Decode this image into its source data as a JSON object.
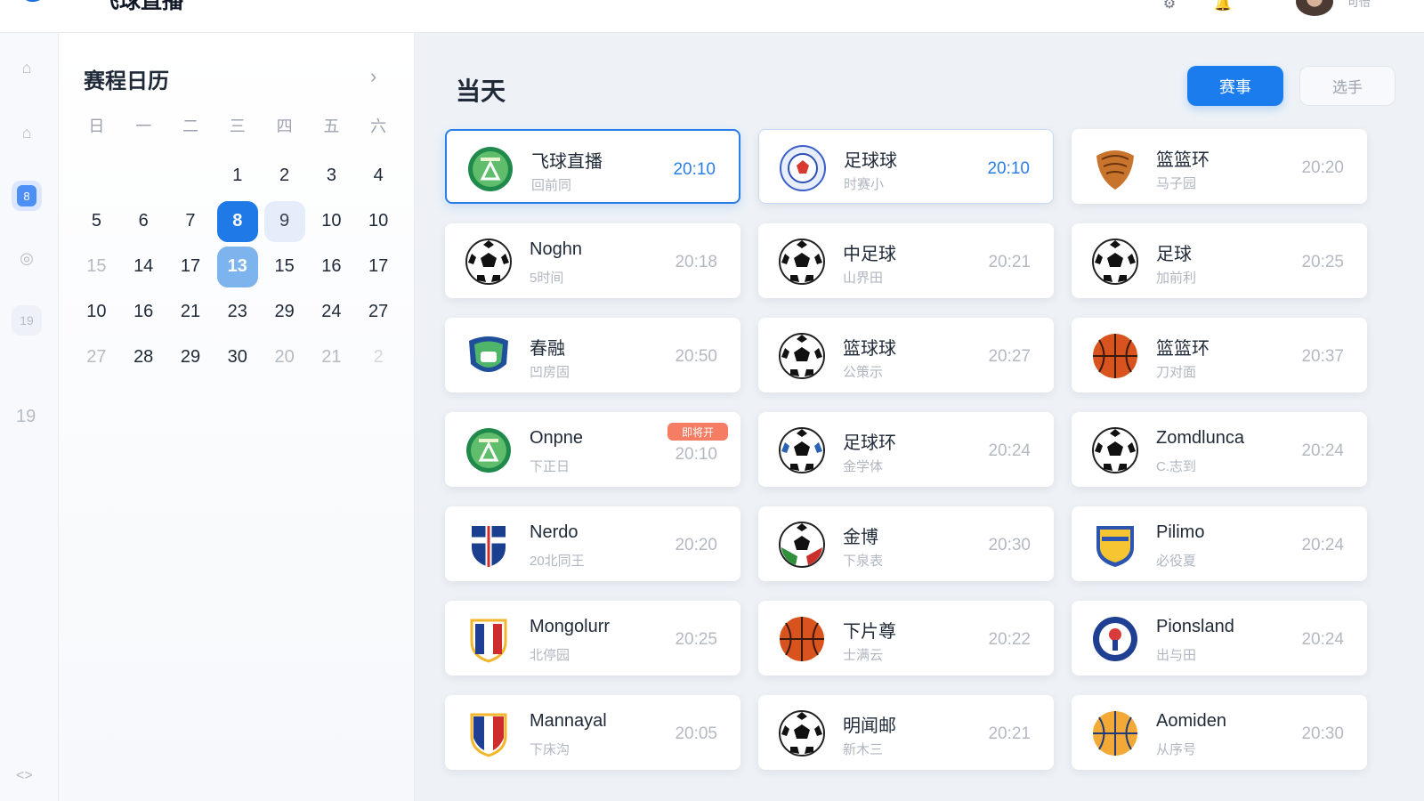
{
  "header": {
    "app_title": "飞球直播",
    "user_name": "可怡",
    "icons": [
      "logo-mark",
      "settings-icon",
      "notification-icon",
      "avatar"
    ]
  },
  "rail": {
    "items": [
      {
        "name": "home",
        "icon": "home-icon",
        "state": "inactive"
      },
      {
        "name": "stadium",
        "icon": "stadium-icon",
        "state": "inactive"
      },
      {
        "name": "schedule",
        "icon": "calendar-icon",
        "state": "active",
        "label": "8"
      },
      {
        "name": "record",
        "icon": "record-icon",
        "state": "inactive"
      },
      {
        "name": "highlights",
        "icon": "highlights-icon",
        "state": "soft",
        "label": "19"
      }
    ],
    "number": "19",
    "bottom": "<>"
  },
  "calendar": {
    "title": "赛程日历",
    "next_icon": "chevron-right-icon",
    "weekdays": [
      "日",
      "一",
      "二",
      "三",
      "四",
      "五",
      "六"
    ],
    "rows": [
      [
        {
          "d": ""
        },
        {
          "d": ""
        },
        {
          "d": ""
        },
        {
          "d": "1"
        },
        {
          "d": "2"
        },
        {
          "d": "3"
        },
        {
          "d": "4"
        }
      ],
      [
        {
          "d": "5"
        },
        {
          "d": "6"
        },
        {
          "d": "7"
        },
        {
          "d": "8",
          "state": "sel"
        },
        {
          "d": "9",
          "state": "near"
        },
        {
          "d": "10"
        },
        {
          "d": "10"
        }
      ],
      [
        {
          "d": "15",
          "state": "muted"
        },
        {
          "d": "14"
        },
        {
          "d": "17"
        },
        {
          "d": "13",
          "state": "today"
        },
        {
          "d": "15"
        },
        {
          "d": "16"
        },
        {
          "d": "17"
        }
      ],
      [
        {
          "d": "10"
        },
        {
          "d": "16"
        },
        {
          "d": "21"
        },
        {
          "d": "23"
        },
        {
          "d": "29"
        },
        {
          "d": "24"
        },
        {
          "d": "27"
        }
      ],
      [
        {
          "d": "27",
          "state": "muted"
        },
        {
          "d": "28"
        },
        {
          "d": "29"
        },
        {
          "d": "30"
        },
        {
          "d": "20",
          "state": "muted"
        },
        {
          "d": "21",
          "state": "muted"
        },
        {
          "d": "2",
          "state": "faint"
        }
      ]
    ]
  },
  "main": {
    "title": "当天",
    "primary_button": "赛事",
    "secondary_button": "选手",
    "badge_text": "即将开",
    "cards": [
      {
        "name": "飞球直播",
        "sub": "回前同",
        "time": "20:10",
        "logo": "green-shield",
        "state": "active",
        "time_color": "blue"
      },
      {
        "name": "足球球",
        "sub": "时赛小",
        "time": "20:10",
        "logo": "blue-ball-crest",
        "state": "soft-active",
        "time_color": "blue"
      },
      {
        "name": "篮篮环",
        "sub": "马子园",
        "time": "20:20",
        "logo": "basket-crest"
      },
      {
        "name": "Noghn",
        "sub": "5时间",
        "time": "20:18",
        "logo": "soccer-ball"
      },
      {
        "name": "中足球",
        "sub": "山界田",
        "time": "20:21",
        "logo": "soccer-ball"
      },
      {
        "name": "足球",
        "sub": "加前利",
        "time": "20:25",
        "logo": "soccer-ball"
      },
      {
        "name": "春融",
        "sub": "凹房固",
        "time": "20:50",
        "logo": "green-blue-crest"
      },
      {
        "name": "篮球球",
        "sub": "公策示",
        "time": "20:27",
        "logo": "soccer-ball"
      },
      {
        "name": "篮篮环",
        "sub": "刀对面",
        "time": "20:37",
        "logo": "basketball"
      },
      {
        "name": "Onpne",
        "sub": "下正日",
        "time": "20:10",
        "logo": "green-shield",
        "badge": true
      },
      {
        "name": "足球环",
        "sub": "金学体",
        "time": "20:24",
        "logo": "soccer-ball-blue"
      },
      {
        "name": "Zomdlunca",
        "sub": "C.志到",
        "time": "20:24",
        "logo": "soccer-ball"
      },
      {
        "name": "Nerdo",
        "sub": "20北同王",
        "time": "20:20",
        "logo": "shield-cross"
      },
      {
        "name": "金博",
        "sub": "下泉表",
        "time": "20:30",
        "logo": "soccer-ball-tricolor"
      },
      {
        "name": "Pilimo",
        "sub": "必役夏",
        "time": "20:24",
        "logo": "shield-yellow"
      },
      {
        "name": "Mongolurr",
        "sub": "北停园",
        "time": "20:25",
        "logo": "shield-stripes"
      },
      {
        "name": "下片尊",
        "sub": "士满云",
        "time": "20:22",
        "logo": "basketball"
      },
      {
        "name": "Pionsland",
        "sub": "出与田",
        "time": "20:24",
        "logo": "round-crest"
      },
      {
        "name": "Mannayal",
        "sub": "下床沟",
        "time": "20:05",
        "logo": "shield-french"
      },
      {
        "name": "明闻邮",
        "sub": "新木三",
        "time": "20:21",
        "logo": "soccer-ball"
      },
      {
        "name": "Aomiden",
        "sub": "从序号",
        "time": "20:30",
        "logo": "basketball-yellow"
      }
    ]
  },
  "colors": {
    "accent": "#1b7ced",
    "selected_day": "#1f7ae8",
    "today_day": "#7db4ee",
    "badge": "#f47d64",
    "background": "#eef2f7"
  }
}
